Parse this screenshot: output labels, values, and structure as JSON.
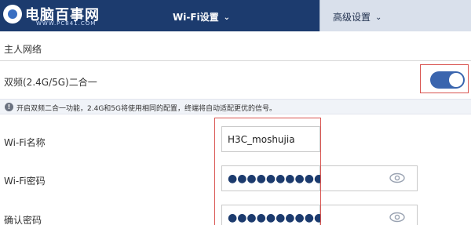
{
  "logo": {
    "text": "电脑百事网",
    "url": "WWW.PC841.COM"
  },
  "tabs": [
    {
      "label": "Wi-Fi设置",
      "active": true
    },
    {
      "label": "高级设置",
      "active": false
    }
  ],
  "section": {
    "title": "主人网络"
  },
  "dual_band": {
    "label": "双频(2.4G/5G)二合一",
    "enabled": true
  },
  "info": {
    "icon": "info-icon",
    "text": "开启双频二合一功能，2.4G和5G将使用相同的配置，终端将自动适配更优的信号。"
  },
  "wifi_name": {
    "label": "Wi-Fi名称",
    "value": "H3C_moshujia"
  },
  "wifi_password": {
    "label": "Wi-Fi密码",
    "value": "●●●●●●●●●●●"
  },
  "confirm_password": {
    "label": "确认密码",
    "value": "●●●●●●●●●●●"
  },
  "colors": {
    "header": "#1c3b6e",
    "toggle_on": "#3a65ae",
    "highlight": "#d9534f"
  }
}
